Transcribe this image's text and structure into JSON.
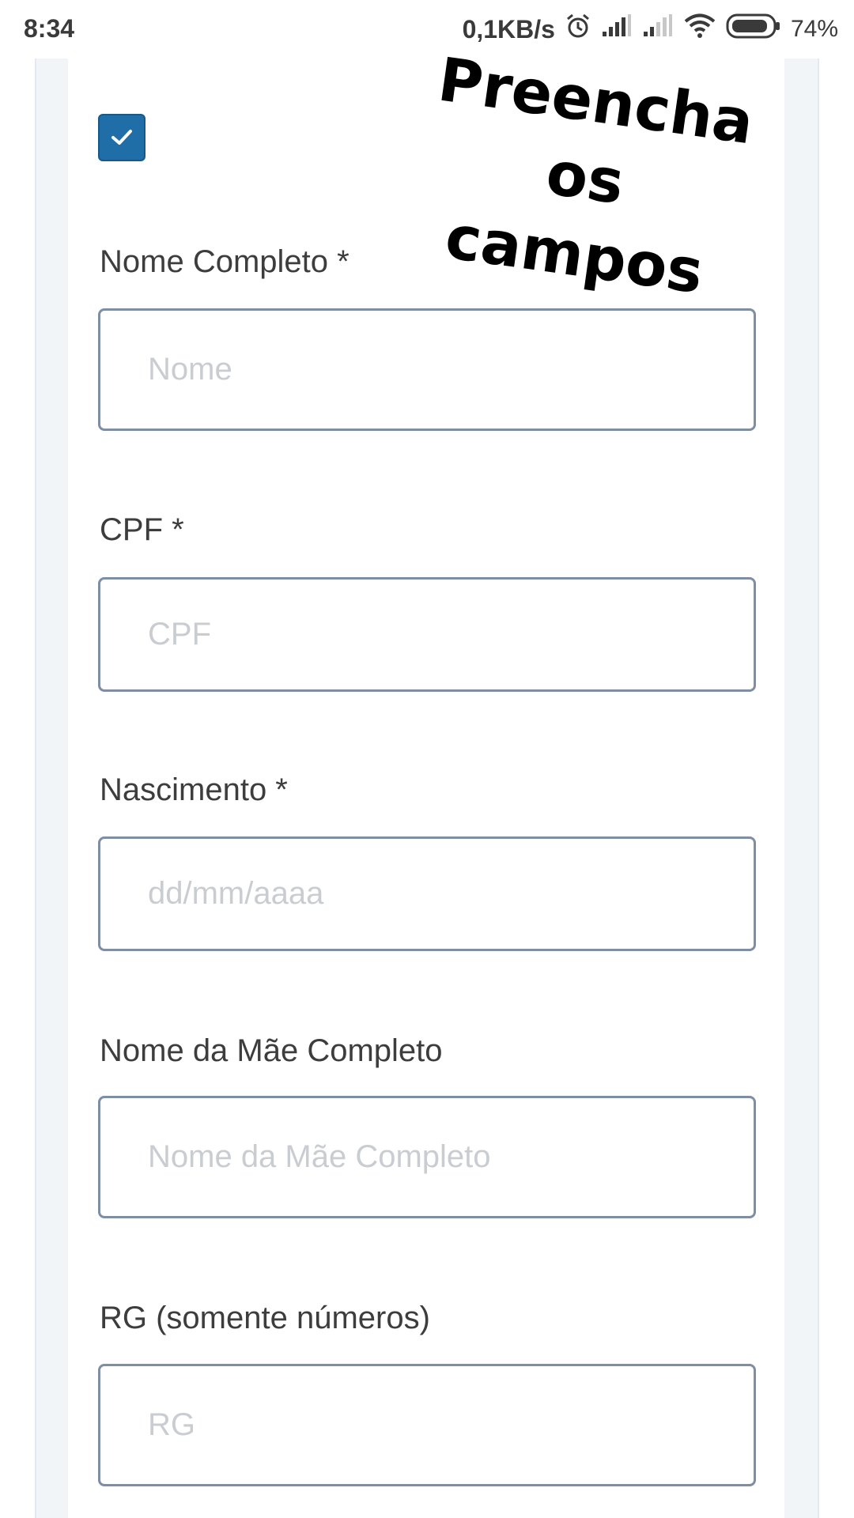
{
  "status_bar": {
    "time": "8:34",
    "speed": "0,1KB/s",
    "battery": "74%",
    "icons": [
      "alarm-icon",
      "signal-icon",
      "signal-weak-icon",
      "wifi-icon",
      "battery-icon"
    ]
  },
  "overlay_title": "Preencha os\ncampos",
  "checkbox": {
    "checked": true,
    "color": "#1f6ea8"
  },
  "form": {
    "nome": {
      "label": "Nome Completo *",
      "placeholder": "Nome",
      "value": ""
    },
    "cpf": {
      "label": "CPF *",
      "placeholder": "CPF",
      "value": ""
    },
    "nascimento": {
      "label": "Nascimento *",
      "placeholder": "dd/mm/aaaa",
      "value": ""
    },
    "mae": {
      "label": "Nome da Mãe Completo",
      "placeholder": "Nome da Mãe Completo",
      "value": ""
    },
    "rg": {
      "label": "RG (somente números)",
      "placeholder": "RG",
      "value": ""
    }
  }
}
